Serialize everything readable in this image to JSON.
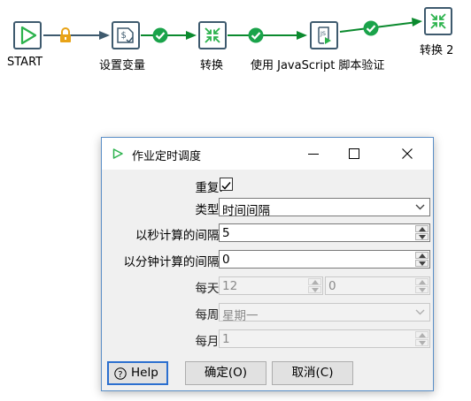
{
  "workflow": {
    "nodes": [
      {
        "label": "START",
        "icon": "start-play-icon"
      },
      {
        "label": "设置变量",
        "icon": "set-variables-icon"
      },
      {
        "label": "转换",
        "icon": "transformation-icon"
      },
      {
        "label": "使用 JavaScript 脚本验证",
        "icon": "javascript-script-icon"
      },
      {
        "label": "转换 2",
        "icon": "transformation-icon"
      }
    ],
    "hops": [
      "unconditional-lock-icon",
      "success-check-icon",
      "success-check-icon",
      "success-check-icon"
    ],
    "colors": {
      "node_border": "#3e5a6e",
      "success": "#1aa34a",
      "hop_arrow_green": "#0b8a2e",
      "hop_arrow_dark": "#3e5a6e",
      "lock": "#e8a317",
      "play": "#2bb24c"
    }
  },
  "dialog": {
    "title": "作业定时调度",
    "fields": {
      "repeat_label": "重复:",
      "repeat_checked": true,
      "type_label": "类型:",
      "type_value": "时间间隔",
      "seconds_label": "以秒计算的间隔:",
      "seconds_value": "5",
      "minutes_label": "以分钟计算的间隔:",
      "minutes_value": "0",
      "daily_label": "每天:",
      "daily_hour": "12",
      "daily_minute": "0",
      "weekly_label": "每周:",
      "weekly_value": "星期一",
      "monthly_label": "每月:",
      "monthly_value": "1"
    },
    "buttons": {
      "help": "Help",
      "ok": "确定(O)",
      "cancel": "取消(C)"
    },
    "colors": {
      "accent": "#2b6fcf",
      "title_icon": "#2bb24c"
    }
  }
}
